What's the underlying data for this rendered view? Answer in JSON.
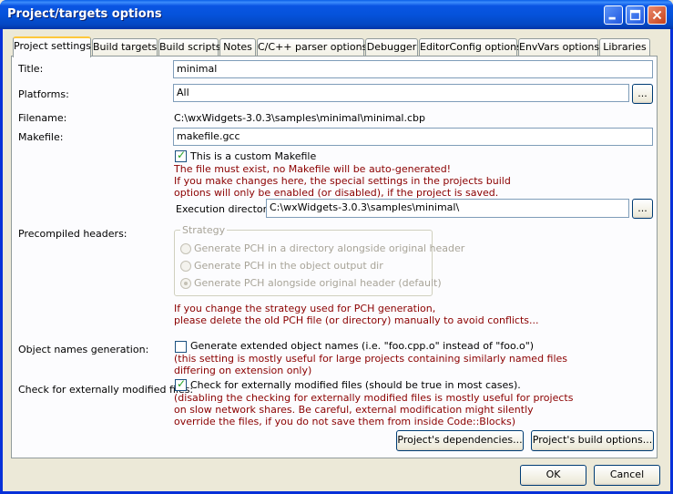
{
  "window": {
    "title": "Project/targets options"
  },
  "tabs": [
    {
      "label": "Project settings"
    },
    {
      "label": "Build targets"
    },
    {
      "label": "Build scripts"
    },
    {
      "label": "Notes"
    },
    {
      "label": "C/C++ parser options"
    },
    {
      "label": "Debugger"
    },
    {
      "label": "EditorConfig options"
    },
    {
      "label": "EnvVars options"
    },
    {
      "label": "Libraries"
    }
  ],
  "form": {
    "title_label": "Title:",
    "title_value": "minimal",
    "platforms_label": "Platforms:",
    "platforms_value": "All",
    "browse_label": "...",
    "filename_label": "Filename:",
    "filename_value": "C:\\wxWidgets-3.0.3\\samples\\minimal\\minimal.cbp",
    "makefile_label": "Makefile:",
    "makefile_value": "makefile.gcc",
    "custom_makefile_label": "This is a custom Makefile",
    "custom_makefile_note1": "The file must exist, no Makefile will be auto-generated!",
    "custom_makefile_note2": "If you make changes here, the special settings in the projects build",
    "custom_makefile_note3": "options will only be enabled (or disabled), if the project is saved.",
    "exec_dir_label": "Execution directory:",
    "exec_dir_value": "C:\\wxWidgets-3.0.3\\samples\\minimal\\",
    "pch_label": "Precompiled headers:",
    "strategy_legend": "Strategy",
    "pch_options": [
      "Generate PCH in a directory alongside original header",
      "Generate PCH in the object output dir",
      "Generate PCH alongside original header (default)"
    ],
    "pch_note1": "If you change the strategy used for PCH generation,",
    "pch_note2": "please delete the old PCH file (or directory) manually to avoid conflicts...",
    "objnames_label": "Object names generation:",
    "objnames_check": "Generate extended object names (i.e. \"foo.cpp.o\" instead of \"foo.o\")",
    "objnames_note1": "(this setting is mostly useful for large projects containing similarly named files",
    "objnames_note2": "differing on extension only)",
    "extmod_label": "Check for externally modified files:",
    "extmod_check": "Check for externally modified files (should be true in most cases).",
    "extmod_note1": "(disabling the checking for externally modified files is mostly useful for projects",
    "extmod_note2": "on slow network shares. Be careful, external modification might silently",
    "extmod_note3": "override the files, if you do not save them from inside Code::Blocks)",
    "deps_button": "Project's dependencies...",
    "build_opts_button": "Project's build options..."
  },
  "footer": {
    "ok": "OK",
    "cancel": "Cancel"
  }
}
